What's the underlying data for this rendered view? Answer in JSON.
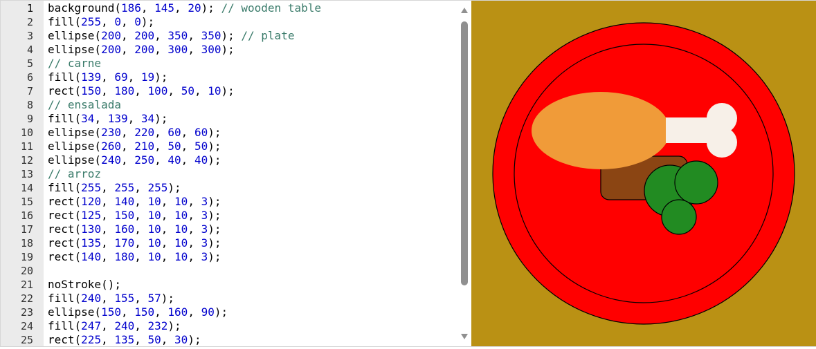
{
  "editor": {
    "lines": [
      {
        "num": "1",
        "tokens": [
          {
            "t": "background(",
            "k": "plain"
          },
          {
            "t": "186",
            "k": "num"
          },
          {
            "t": ", ",
            "k": "plain"
          },
          {
            "t": "145",
            "k": "num"
          },
          {
            "t": ", ",
            "k": "plain"
          },
          {
            "t": "20",
            "k": "num"
          },
          {
            "t": "); ",
            "k": "plain"
          },
          {
            "t": "// wooden table",
            "k": "comment"
          }
        ]
      },
      {
        "num": "2",
        "tokens": [
          {
            "t": "fill(",
            "k": "plain"
          },
          {
            "t": "255",
            "k": "num"
          },
          {
            "t": ", ",
            "k": "plain"
          },
          {
            "t": "0",
            "k": "num"
          },
          {
            "t": ", ",
            "k": "plain"
          },
          {
            "t": "0",
            "k": "num"
          },
          {
            "t": ");",
            "k": "plain"
          }
        ]
      },
      {
        "num": "3",
        "tokens": [
          {
            "t": "ellipse(",
            "k": "plain"
          },
          {
            "t": "200",
            "k": "num"
          },
          {
            "t": ", ",
            "k": "plain"
          },
          {
            "t": "200",
            "k": "num"
          },
          {
            "t": ", ",
            "k": "plain"
          },
          {
            "t": "350",
            "k": "num"
          },
          {
            "t": ", ",
            "k": "plain"
          },
          {
            "t": "350",
            "k": "num"
          },
          {
            "t": "); ",
            "k": "plain"
          },
          {
            "t": "// plate",
            "k": "comment"
          }
        ]
      },
      {
        "num": "4",
        "tokens": [
          {
            "t": "ellipse(",
            "k": "plain"
          },
          {
            "t": "200",
            "k": "num"
          },
          {
            "t": ", ",
            "k": "plain"
          },
          {
            "t": "200",
            "k": "num"
          },
          {
            "t": ", ",
            "k": "plain"
          },
          {
            "t": "300",
            "k": "num"
          },
          {
            "t": ", ",
            "k": "plain"
          },
          {
            "t": "300",
            "k": "num"
          },
          {
            "t": ");",
            "k": "plain"
          }
        ]
      },
      {
        "num": "5",
        "tokens": [
          {
            "t": "// carne",
            "k": "comment"
          }
        ]
      },
      {
        "num": "6",
        "tokens": [
          {
            "t": "fill(",
            "k": "plain"
          },
          {
            "t": "139",
            "k": "num"
          },
          {
            "t": ", ",
            "k": "plain"
          },
          {
            "t": "69",
            "k": "num"
          },
          {
            "t": ", ",
            "k": "plain"
          },
          {
            "t": "19",
            "k": "num"
          },
          {
            "t": ");",
            "k": "plain"
          }
        ]
      },
      {
        "num": "7",
        "tokens": [
          {
            "t": "rect(",
            "k": "plain"
          },
          {
            "t": "150",
            "k": "num"
          },
          {
            "t": ", ",
            "k": "plain"
          },
          {
            "t": "180",
            "k": "num"
          },
          {
            "t": ", ",
            "k": "plain"
          },
          {
            "t": "100",
            "k": "num"
          },
          {
            "t": ", ",
            "k": "plain"
          },
          {
            "t": "50",
            "k": "num"
          },
          {
            "t": ", ",
            "k": "plain"
          },
          {
            "t": "10",
            "k": "num"
          },
          {
            "t": ");",
            "k": "plain"
          }
        ]
      },
      {
        "num": "8",
        "tokens": [
          {
            "t": "// ensalada",
            "k": "comment"
          }
        ]
      },
      {
        "num": "9",
        "tokens": [
          {
            "t": "fill(",
            "k": "plain"
          },
          {
            "t": "34",
            "k": "num"
          },
          {
            "t": ", ",
            "k": "plain"
          },
          {
            "t": "139",
            "k": "num"
          },
          {
            "t": ", ",
            "k": "plain"
          },
          {
            "t": "34",
            "k": "num"
          },
          {
            "t": ");",
            "k": "plain"
          }
        ]
      },
      {
        "num": "10",
        "tokens": [
          {
            "t": "ellipse(",
            "k": "plain"
          },
          {
            "t": "230",
            "k": "num"
          },
          {
            "t": ", ",
            "k": "plain"
          },
          {
            "t": "220",
            "k": "num"
          },
          {
            "t": ", ",
            "k": "plain"
          },
          {
            "t": "60",
            "k": "num"
          },
          {
            "t": ", ",
            "k": "plain"
          },
          {
            "t": "60",
            "k": "num"
          },
          {
            "t": ");",
            "k": "plain"
          }
        ]
      },
      {
        "num": "11",
        "tokens": [
          {
            "t": "ellipse(",
            "k": "plain"
          },
          {
            "t": "260",
            "k": "num"
          },
          {
            "t": ", ",
            "k": "plain"
          },
          {
            "t": "210",
            "k": "num"
          },
          {
            "t": ", ",
            "k": "plain"
          },
          {
            "t": "50",
            "k": "num"
          },
          {
            "t": ", ",
            "k": "plain"
          },
          {
            "t": "50",
            "k": "num"
          },
          {
            "t": ");",
            "k": "plain"
          }
        ]
      },
      {
        "num": "12",
        "tokens": [
          {
            "t": "ellipse(",
            "k": "plain"
          },
          {
            "t": "240",
            "k": "num"
          },
          {
            "t": ", ",
            "k": "plain"
          },
          {
            "t": "250",
            "k": "num"
          },
          {
            "t": ", ",
            "k": "plain"
          },
          {
            "t": "40",
            "k": "num"
          },
          {
            "t": ", ",
            "k": "plain"
          },
          {
            "t": "40",
            "k": "num"
          },
          {
            "t": ");",
            "k": "plain"
          }
        ]
      },
      {
        "num": "13",
        "tokens": [
          {
            "t": "// arroz",
            "k": "comment"
          }
        ]
      },
      {
        "num": "14",
        "tokens": [
          {
            "t": "fill(",
            "k": "plain"
          },
          {
            "t": "255",
            "k": "num"
          },
          {
            "t": ", ",
            "k": "plain"
          },
          {
            "t": "255",
            "k": "num"
          },
          {
            "t": ", ",
            "k": "plain"
          },
          {
            "t": "255",
            "k": "num"
          },
          {
            "t": ");",
            "k": "plain"
          }
        ]
      },
      {
        "num": "15",
        "tokens": [
          {
            "t": "rect(",
            "k": "plain"
          },
          {
            "t": "120",
            "k": "num"
          },
          {
            "t": ", ",
            "k": "plain"
          },
          {
            "t": "140",
            "k": "num"
          },
          {
            "t": ", ",
            "k": "plain"
          },
          {
            "t": "10",
            "k": "num"
          },
          {
            "t": ", ",
            "k": "plain"
          },
          {
            "t": "10",
            "k": "num"
          },
          {
            "t": ", ",
            "k": "plain"
          },
          {
            "t": "3",
            "k": "num"
          },
          {
            "t": ");",
            "k": "plain"
          }
        ]
      },
      {
        "num": "16",
        "tokens": [
          {
            "t": "rect(",
            "k": "plain"
          },
          {
            "t": "125",
            "k": "num"
          },
          {
            "t": ", ",
            "k": "plain"
          },
          {
            "t": "150",
            "k": "num"
          },
          {
            "t": ", ",
            "k": "plain"
          },
          {
            "t": "10",
            "k": "num"
          },
          {
            "t": ", ",
            "k": "plain"
          },
          {
            "t": "10",
            "k": "num"
          },
          {
            "t": ", ",
            "k": "plain"
          },
          {
            "t": "3",
            "k": "num"
          },
          {
            "t": ");",
            "k": "plain"
          }
        ]
      },
      {
        "num": "17",
        "tokens": [
          {
            "t": "rect(",
            "k": "plain"
          },
          {
            "t": "130",
            "k": "num"
          },
          {
            "t": ", ",
            "k": "plain"
          },
          {
            "t": "160",
            "k": "num"
          },
          {
            "t": ", ",
            "k": "plain"
          },
          {
            "t": "10",
            "k": "num"
          },
          {
            "t": ", ",
            "k": "plain"
          },
          {
            "t": "10",
            "k": "num"
          },
          {
            "t": ", ",
            "k": "plain"
          },
          {
            "t": "3",
            "k": "num"
          },
          {
            "t": ");",
            "k": "plain"
          }
        ]
      },
      {
        "num": "18",
        "tokens": [
          {
            "t": "rect(",
            "k": "plain"
          },
          {
            "t": "135",
            "k": "num"
          },
          {
            "t": ", ",
            "k": "plain"
          },
          {
            "t": "170",
            "k": "num"
          },
          {
            "t": ", ",
            "k": "plain"
          },
          {
            "t": "10",
            "k": "num"
          },
          {
            "t": ", ",
            "k": "plain"
          },
          {
            "t": "10",
            "k": "num"
          },
          {
            "t": ", ",
            "k": "plain"
          },
          {
            "t": "3",
            "k": "num"
          },
          {
            "t": ");",
            "k": "plain"
          }
        ]
      },
      {
        "num": "19",
        "tokens": [
          {
            "t": "rect(",
            "k": "plain"
          },
          {
            "t": "140",
            "k": "num"
          },
          {
            "t": ", ",
            "k": "plain"
          },
          {
            "t": "180",
            "k": "num"
          },
          {
            "t": ", ",
            "k": "plain"
          },
          {
            "t": "10",
            "k": "num"
          },
          {
            "t": ", ",
            "k": "plain"
          },
          {
            "t": "10",
            "k": "num"
          },
          {
            "t": ", ",
            "k": "plain"
          },
          {
            "t": "3",
            "k": "num"
          },
          {
            "t": ");",
            "k": "plain"
          }
        ]
      },
      {
        "num": "20",
        "tokens": []
      },
      {
        "num": "21",
        "tokens": [
          {
            "t": "noStroke();",
            "k": "plain"
          }
        ]
      },
      {
        "num": "22",
        "tokens": [
          {
            "t": "fill(",
            "k": "plain"
          },
          {
            "t": "240",
            "k": "num"
          },
          {
            "t": ", ",
            "k": "plain"
          },
          {
            "t": "155",
            "k": "num"
          },
          {
            "t": ", ",
            "k": "plain"
          },
          {
            "t": "57",
            "k": "num"
          },
          {
            "t": ");",
            "k": "plain"
          }
        ]
      },
      {
        "num": "23",
        "tokens": [
          {
            "t": "ellipse(",
            "k": "plain"
          },
          {
            "t": "150",
            "k": "num"
          },
          {
            "t": ", ",
            "k": "plain"
          },
          {
            "t": "150",
            "k": "num"
          },
          {
            "t": ", ",
            "k": "plain"
          },
          {
            "t": "160",
            "k": "num"
          },
          {
            "t": ", ",
            "k": "plain"
          },
          {
            "t": "90",
            "k": "num"
          },
          {
            "t": ");",
            "k": "plain"
          }
        ]
      },
      {
        "num": "24",
        "tokens": [
          {
            "t": "fill(",
            "k": "plain"
          },
          {
            "t": "247",
            "k": "num"
          },
          {
            "t": ", ",
            "k": "plain"
          },
          {
            "t": "240",
            "k": "num"
          },
          {
            "t": ", ",
            "k": "plain"
          },
          {
            "t": "232",
            "k": "num"
          },
          {
            "t": ");",
            "k": "plain"
          }
        ]
      },
      {
        "num": "25",
        "tokens": [
          {
            "t": "rect(",
            "k": "plain"
          },
          {
            "t": "225",
            "k": "num"
          },
          {
            "t": ", ",
            "k": "plain"
          },
          {
            "t": "135",
            "k": "num"
          },
          {
            "t": ", ",
            "k": "plain"
          },
          {
            "t": "50",
            "k": "num"
          },
          {
            "t": ", ",
            "k": "plain"
          },
          {
            "t": "30",
            "k": "num"
          },
          {
            "t": ");",
            "k": "plain"
          }
        ]
      }
    ],
    "scrollbar": {
      "up_icon": "triangle-up-icon",
      "down_icon": "triangle-down-icon",
      "color": "#909090"
    }
  },
  "colors": {
    "gutter": "#ebebeb",
    "number_token": "#0000cd",
    "comment_token": "#3a7b6a",
    "table": "#ba9114",
    "plate": "#ff0000",
    "steak": "#8b4513",
    "salad": "#228b22",
    "chicken": "#f09b39",
    "bone": "#f7f0e8"
  },
  "output_canvas": {
    "description_free": true
  }
}
